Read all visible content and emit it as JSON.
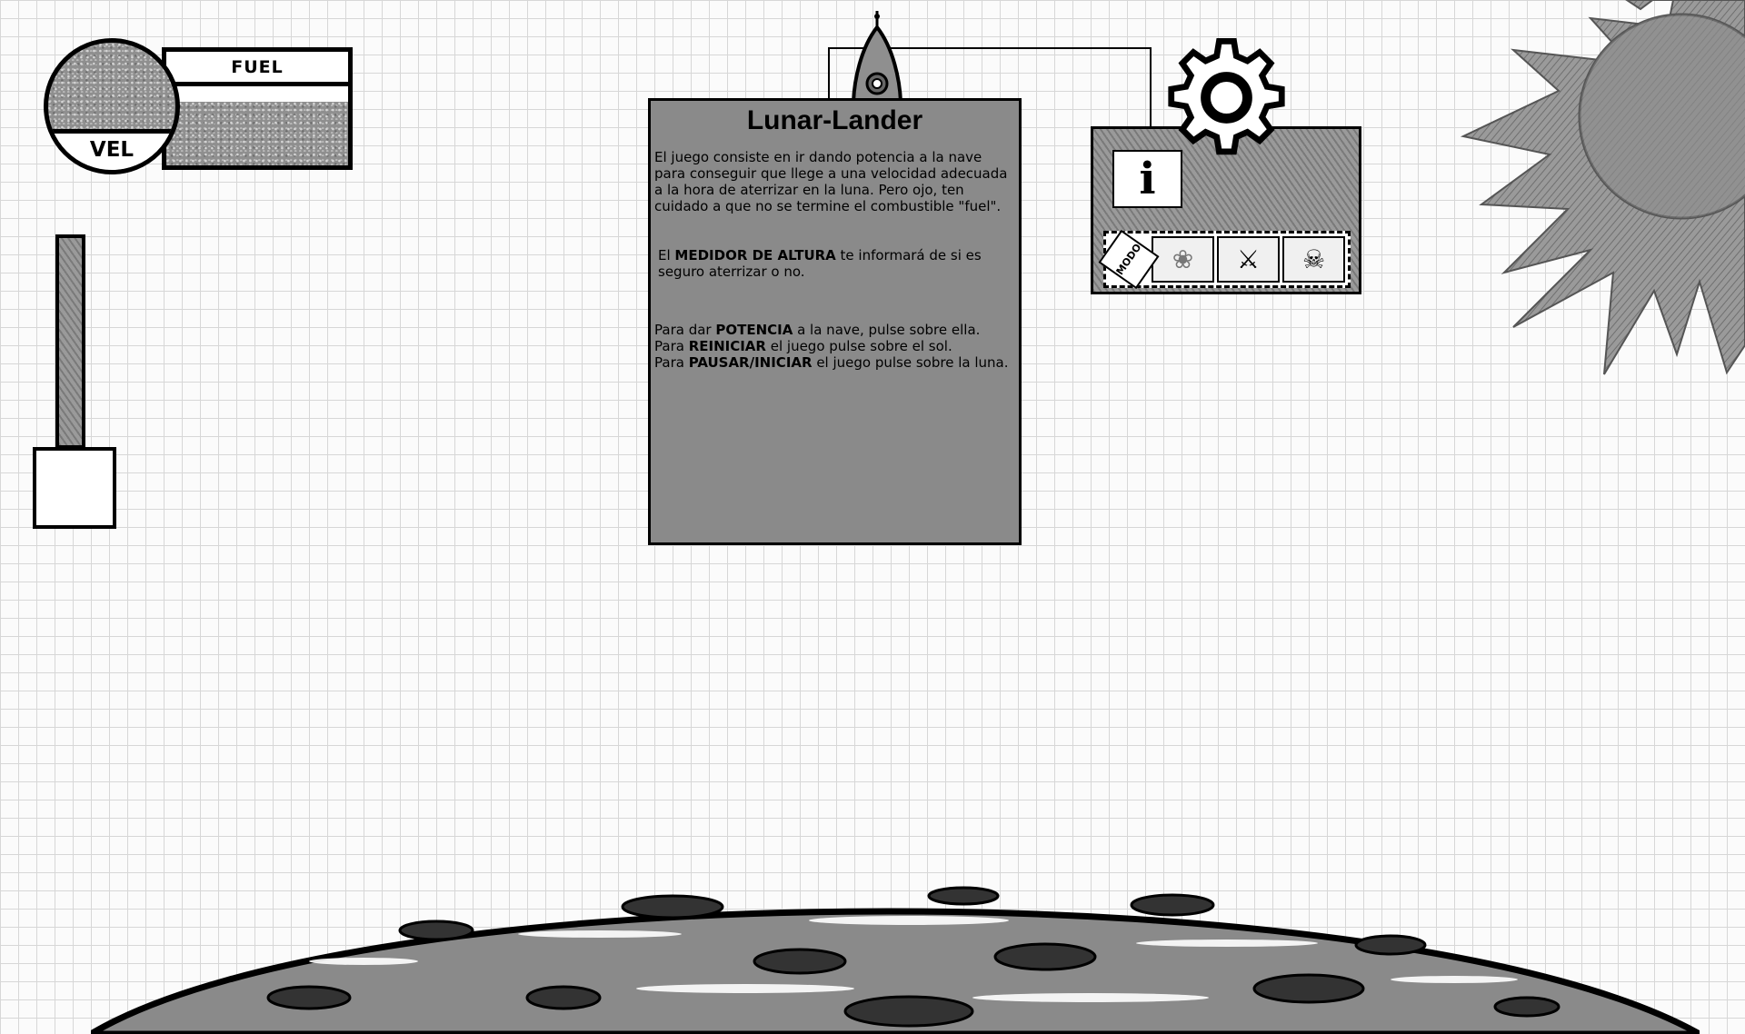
{
  "hud": {
    "fuel_label": "FUEL",
    "vel_label": "VEL",
    "fuel_level": 0.8
  },
  "altimeter": {
    "level": 0.82
  },
  "info_panel": {
    "title": "Lunar-Lander",
    "intro": "El juego consiste en ir dando potencia a la nave para conseguir que llege a una velocidad adecuada a la hora de aterrizar en la luna. Pero ojo, ten cuidado a que no se termine el combustible \"fuel\".",
    "alt_prefix": "El ",
    "alt_bold": "MEDIDOR DE ALTURA",
    "alt_suffix": " te informará de si es seguro aterrizar o no.",
    "line1_prefix": "Para dar ",
    "line1_bold": "POTENCIA",
    "line1_suffix": " a la nave, pulse sobre ella.",
    "line2_prefix": "Para ",
    "line2_bold": "REINICIAR",
    "line2_suffix": " el juego pulse sobre el sol.",
    "line3_prefix": "Para ",
    "line3_bold": "PAUSAR/INICIAR",
    "line3_suffix": " el juego pulse sobre la luna."
  },
  "settings": {
    "info_glyph": "i",
    "mode_label": "MODO",
    "modes": [
      {
        "name": "easy",
        "icon": "flower-icon",
        "glyph": "❀"
      },
      {
        "name": "normal",
        "icon": "crossed-swords-icon",
        "glyph": "⚔"
      },
      {
        "name": "hard",
        "icon": "skull-crossbones-icon",
        "glyph": "☠"
      }
    ]
  }
}
